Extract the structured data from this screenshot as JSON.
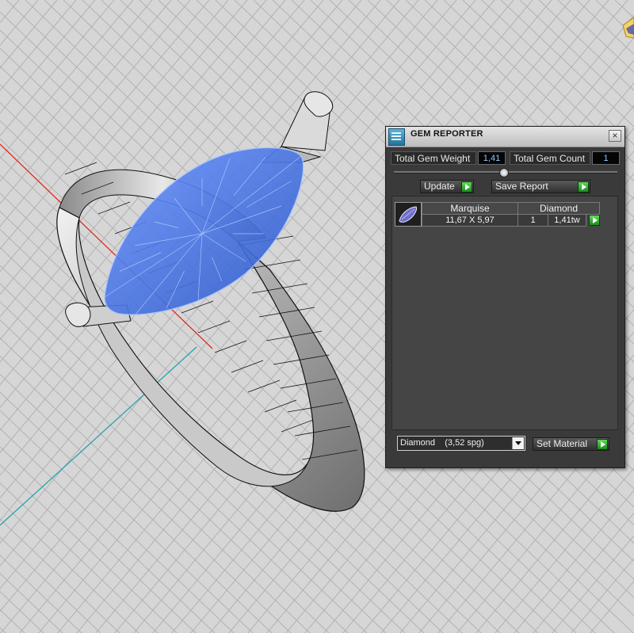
{
  "panel": {
    "title": "GEM REPORTER",
    "close_glyph": "×",
    "icon": "gem-reporter-icon",
    "total_weight_label": "Total Gem Weight",
    "total_weight_value": "1,41",
    "total_count_label": "Total Gem Count",
    "total_count_value": "1",
    "update_label": "Update",
    "save_report_label": "Save Report",
    "table": {
      "headers": [
        "Marquise",
        "Diamond"
      ],
      "rows": [
        {
          "size": "11,67 X 5,97",
          "count": "1",
          "weight": "1,41tw"
        }
      ]
    },
    "material": {
      "selected": "Diamond    (3,52 spg)",
      "button_label": "Set Material"
    }
  },
  "colors": {
    "viewport_bg": "#d6d6d6",
    "gem_blue": "#4a78e8",
    "accent_green": "#2fa22b",
    "axis_red": "#e0281c",
    "axis_teal": "#2aa0ad"
  }
}
